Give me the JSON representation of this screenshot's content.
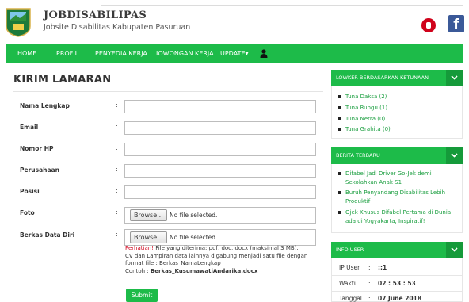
{
  "header": {
    "title": "JOBDISABILIPAS",
    "subtitle": "Jobsite Disabilitas Kabupaten Pasuruan",
    "icons": [
      "logo-icon",
      "youtube-icon",
      "facebook-icon"
    ]
  },
  "nav": {
    "items": [
      "HOME",
      "PROFIL",
      "PENYEDIA KERJA",
      "IOWONGAN KERJA",
      "UPDATE▾"
    ],
    "user_icon": "user-icon"
  },
  "form": {
    "title": "KIRIM LAMARAN",
    "colon": ":",
    "fields": [
      {
        "label": "Nama Lengkap",
        "value": ""
      },
      {
        "label": "Email",
        "value": ""
      },
      {
        "label": "Nomor HP",
        "value": ""
      },
      {
        "label": "Perusahaan",
        "value": ""
      },
      {
        "label": "Posisi",
        "value": ""
      }
    ],
    "foto": {
      "label": "Foto",
      "button": "Browse...",
      "status": "No file selected."
    },
    "berkas": {
      "label": "Berkas Data Diri",
      "button": "Browse...",
      "status": "No file selected."
    },
    "note": {
      "warn": "Perhatian!",
      "line1": " File yang diterima: pdf, doc, docx (maksimal 3 MB).",
      "line2": "CV dan Lampiran data lainnya digabung menjadi satu file dengan",
      "line3": "format file : Berkas_NamaLengkap",
      "line4_prefix": "Contoh : ",
      "line4_bold": "Berkas_KusumawatiAndarika.docx"
    },
    "submit": "Submit"
  },
  "sidebar": {
    "lowker": {
      "title": "LOWKER BERDASARKAN KETUNAAN",
      "items": [
        "Tuna Daksa (2)",
        "Tuna Rungu (1)",
        "Tuna Netra (0)",
        "Tuna Grahita (0)"
      ]
    },
    "berita": {
      "title": "BERITA TERBARU",
      "items": [
        "Difabel Jadi Driver Go-Jek demi Sekolahkan Anak S1",
        "Buruh Penyandang Disabilitas Lebih Produktif",
        "Ojek Khusus Difabel Pertama di Dunia ada di Yogyakarta, Inspiratif!"
      ]
    },
    "info": {
      "title": "INFO USER",
      "rows": [
        {
          "key": "IP User",
          "sep": ":",
          "value": "::1"
        },
        {
          "key": "Waktu",
          "sep": ":",
          "value": "02 : 53 : 53"
        },
        {
          "key": "Tanggal",
          "sep": ":",
          "value": "07 June 2018"
        }
      ]
    }
  },
  "colors": {
    "accent": "#1dbb49",
    "accent_dark": "#159a3a",
    "warning": "#d0021b",
    "link": "#1a9e3f"
  }
}
